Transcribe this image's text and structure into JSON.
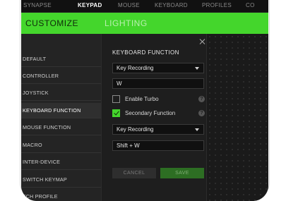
{
  "nav": {
    "items": [
      "SYNAPSE",
      "KEYPAD",
      "MOUSE",
      "KEYBOARD",
      "PROFILES",
      "CO"
    ],
    "active": "KEYPAD"
  },
  "header": {
    "tabs": [
      "CUSTOMIZE",
      "LIGHTING"
    ],
    "active": "CUSTOMIZE",
    "accent_color": "#44d62c"
  },
  "sidebar": {
    "items": [
      "DEFAULT",
      "CONTROLLER",
      "JOYSTICK",
      "KEYBOARD FUNCTION",
      "MOUSE FUNCTION",
      "MACRO",
      "INTER-DEVICE",
      "SWITCH KEYMAP",
      "TCH PROFILE"
    ],
    "active": "KEYBOARD FUNCTION"
  },
  "panel": {
    "title": "KEYBOARD FUNCTION",
    "function_select": "Key Recording",
    "key_value": "W",
    "enable_turbo": {
      "label": "Enable Turbo",
      "checked": false
    },
    "secondary_function": {
      "label": "Secondary Function",
      "checked": true
    },
    "secondary_select": "Key Recording",
    "secondary_value": "Shift + W",
    "help_glyph": "?",
    "cancel_label": "CANCEL",
    "save_label": "SAVE"
  }
}
